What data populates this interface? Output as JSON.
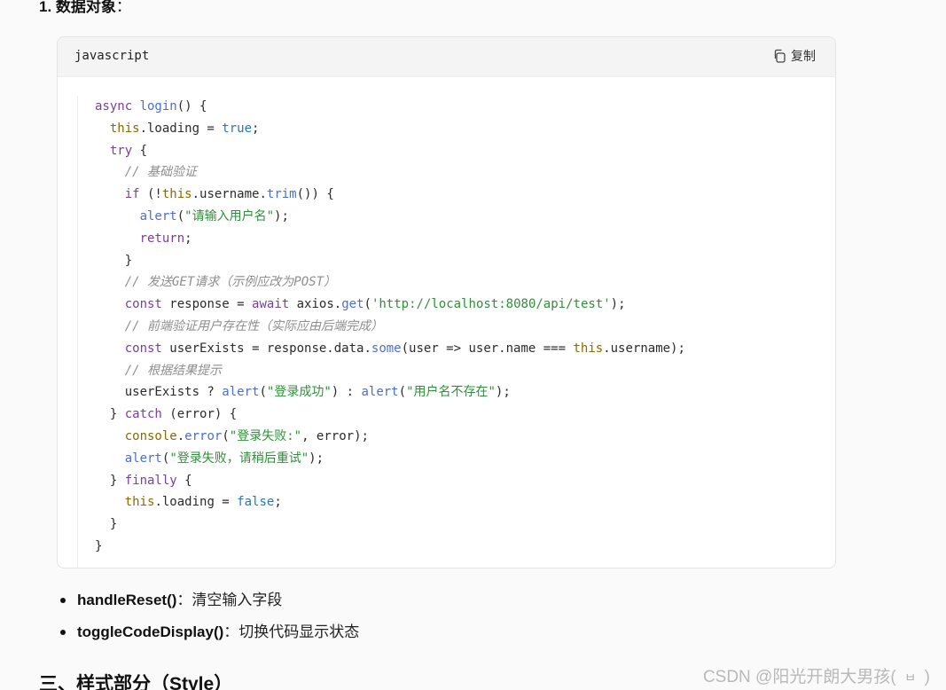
{
  "section": {
    "number": "1. ",
    "title": "数据对象",
    "colon": "："
  },
  "code_block": {
    "language": "javascript",
    "copy_label": "复制",
    "lines": [
      [
        {
          "t": "async ",
          "c": "kw"
        },
        {
          "t": "login",
          "c": "fn"
        },
        {
          "t": "() {",
          "c": ""
        }
      ],
      [
        {
          "t": "  ",
          "c": ""
        },
        {
          "t": "this",
          "c": "th"
        },
        {
          "t": ".loading = ",
          "c": ""
        },
        {
          "t": "true",
          "c": "bool"
        },
        {
          "t": ";",
          "c": ""
        }
      ],
      [
        {
          "t": "  ",
          "c": ""
        },
        {
          "t": "try",
          "c": "kw"
        },
        {
          "t": " {",
          "c": ""
        }
      ],
      [
        {
          "t": "    ",
          "c": ""
        },
        {
          "t": "// 基础验证",
          "c": "cm"
        }
      ],
      [
        {
          "t": "    ",
          "c": ""
        },
        {
          "t": "if",
          "c": "kw"
        },
        {
          "t": " (!",
          "c": ""
        },
        {
          "t": "this",
          "c": "th"
        },
        {
          "t": ".username.",
          "c": ""
        },
        {
          "t": "trim",
          "c": "fn"
        },
        {
          "t": "()) {",
          "c": ""
        }
      ],
      [
        {
          "t": "      ",
          "c": ""
        },
        {
          "t": "alert",
          "c": "fn"
        },
        {
          "t": "(",
          "c": ""
        },
        {
          "t": "\"请输入用户名\"",
          "c": "str"
        },
        {
          "t": ");",
          "c": ""
        }
      ],
      [
        {
          "t": "      ",
          "c": ""
        },
        {
          "t": "return",
          "c": "kw"
        },
        {
          "t": ";",
          "c": ""
        }
      ],
      [
        {
          "t": "    }",
          "c": ""
        }
      ],
      [
        {
          "t": "    ",
          "c": ""
        },
        {
          "t": "// 发送GET请求（示例应改为POST）",
          "c": "cm"
        }
      ],
      [
        {
          "t": "    ",
          "c": ""
        },
        {
          "t": "const",
          "c": "kw"
        },
        {
          "t": " response = ",
          "c": ""
        },
        {
          "t": "await",
          "c": "kw"
        },
        {
          "t": " axios.",
          "c": ""
        },
        {
          "t": "get",
          "c": "fn"
        },
        {
          "t": "(",
          "c": ""
        },
        {
          "t": "'http://localhost:8080/api/test'",
          "c": "str"
        },
        {
          "t": ");",
          "c": ""
        }
      ],
      [
        {
          "t": "    ",
          "c": ""
        },
        {
          "t": "// 前端验证用户存在性（实际应由后端完成）",
          "c": "cm"
        }
      ],
      [
        {
          "t": "    ",
          "c": ""
        },
        {
          "t": "const",
          "c": "kw"
        },
        {
          "t": " userExists = response.data.",
          "c": ""
        },
        {
          "t": "some",
          "c": "fn"
        },
        {
          "t": "(user => user.name === ",
          "c": ""
        },
        {
          "t": "this",
          "c": "th"
        },
        {
          "t": ".username);",
          "c": ""
        }
      ],
      [
        {
          "t": "    ",
          "c": ""
        },
        {
          "t": "// 根据结果提示",
          "c": "cm"
        }
      ],
      [
        {
          "t": "    userExists ? ",
          "c": ""
        },
        {
          "t": "alert",
          "c": "fn"
        },
        {
          "t": "(",
          "c": ""
        },
        {
          "t": "\"登录成功\"",
          "c": "str"
        },
        {
          "t": ") : ",
          "c": ""
        },
        {
          "t": "alert",
          "c": "fn"
        },
        {
          "t": "(",
          "c": ""
        },
        {
          "t": "\"用户名不存在\"",
          "c": "str"
        },
        {
          "t": ");",
          "c": ""
        }
      ],
      [
        {
          "t": "  } ",
          "c": ""
        },
        {
          "t": "catch",
          "c": "kw"
        },
        {
          "t": " (error) {",
          "c": ""
        }
      ],
      [
        {
          "t": "    ",
          "c": ""
        },
        {
          "t": "console",
          "c": "th"
        },
        {
          "t": ".",
          "c": ""
        },
        {
          "t": "error",
          "c": "fn"
        },
        {
          "t": "(",
          "c": ""
        },
        {
          "t": "\"登录失败:\"",
          "c": "str"
        },
        {
          "t": ", error);",
          "c": ""
        }
      ],
      [
        {
          "t": "    ",
          "c": ""
        },
        {
          "t": "alert",
          "c": "fn"
        },
        {
          "t": "(",
          "c": ""
        },
        {
          "t": "\"登录失败，请稍后重试\"",
          "c": "str"
        },
        {
          "t": ");",
          "c": ""
        }
      ],
      [
        {
          "t": "  } ",
          "c": ""
        },
        {
          "t": "finally",
          "c": "kw"
        },
        {
          "t": " {",
          "c": ""
        }
      ],
      [
        {
          "t": "    ",
          "c": ""
        },
        {
          "t": "this",
          "c": "th"
        },
        {
          "t": ".loading = ",
          "c": ""
        },
        {
          "t": "false",
          "c": "bool"
        },
        {
          "t": ";",
          "c": ""
        }
      ],
      [
        {
          "t": "  }",
          "c": ""
        }
      ],
      [
        {
          "t": "}",
          "c": ""
        }
      ]
    ]
  },
  "bullets": [
    {
      "name": "handleReset()",
      "desc": "：清空输入字段"
    },
    {
      "name": "toggleCodeDisplay()",
      "desc": "：切换代码显示状态"
    }
  ],
  "next_heading": "三、样式部分（Style）",
  "watermark": {
    "text": "CSDN @阳光开朗大男孩(",
    "icon": "ㅂ",
    "close": ")"
  },
  "colors": {
    "keyword": "#7a3e9d",
    "function": "#4a6fd1",
    "this": "#8a6a00",
    "boolean": "#1f7ab6",
    "string": "#2f8f3a",
    "comment": "#8e8e8e"
  }
}
